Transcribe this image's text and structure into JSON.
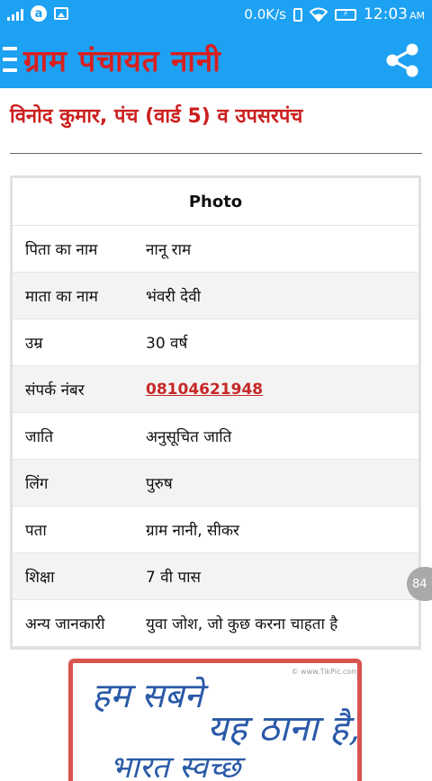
{
  "status_bar": {
    "net_speed": "0.0K/s",
    "time": "12:03",
    "ampm": "AM",
    "battery_symbol": "⚡",
    "notification_glyph": "a"
  },
  "app_bar": {
    "title": "ग्राम पंचायत नानी",
    "accent_color": "#1da1f2",
    "title_color": "#d81f1f"
  },
  "profile": {
    "heading": "विनोद कुमार, पंच (वार्ड 5) व उपसरपंच",
    "photo_label": "Photo",
    "rows": [
      {
        "label": "पिता का नाम",
        "value": "नानू राम"
      },
      {
        "label": "माता का नाम",
        "value": "भंवरी देवी"
      },
      {
        "label": "उम्र",
        "value": "30 वर्ष"
      },
      {
        "label": "संपर्क नंबर",
        "value": "08104621948"
      },
      {
        "label": "जाति",
        "value": "अनुसूचित जाति"
      },
      {
        "label": "लिंग",
        "value": "पुरुष"
      },
      {
        "label": "पता",
        "value": "ग्राम नानी, सीकर"
      },
      {
        "label": "शिक्षा",
        "value": "7 वी पास"
      },
      {
        "label": "अन्य जानकारी",
        "value": "युवा जोश, जो कुछ करना चाहता है"
      }
    ]
  },
  "floating_bubble": {
    "count": "84"
  },
  "banner": {
    "line1": "हम सबने",
    "line2": "यह ठाना है,",
    "line3": "भारत स्वच्छ",
    "watermark": "© www.TikPic.com"
  }
}
